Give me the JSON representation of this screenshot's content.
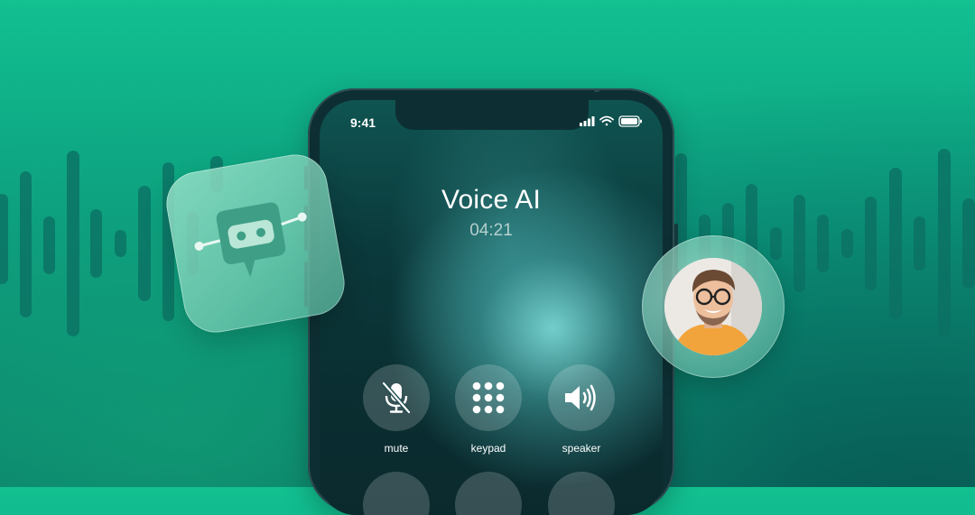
{
  "status_bar": {
    "time": "9:41"
  },
  "call": {
    "title": "Voice AI",
    "duration": "04:21"
  },
  "controls": [
    {
      "label": "mute",
      "icon": "mic-off-icon"
    },
    {
      "label": "keypad",
      "icon": "keypad-icon"
    },
    {
      "label": "speaker",
      "icon": "speaker-icon"
    }
  ],
  "colors": {
    "background": "#12c090",
    "accent_dark": "#0b6f63",
    "phone_frame": "#0d2f33"
  },
  "decorations": {
    "left_tile_icon": "chat-bot-icon",
    "right_bubble": "user-avatar"
  }
}
